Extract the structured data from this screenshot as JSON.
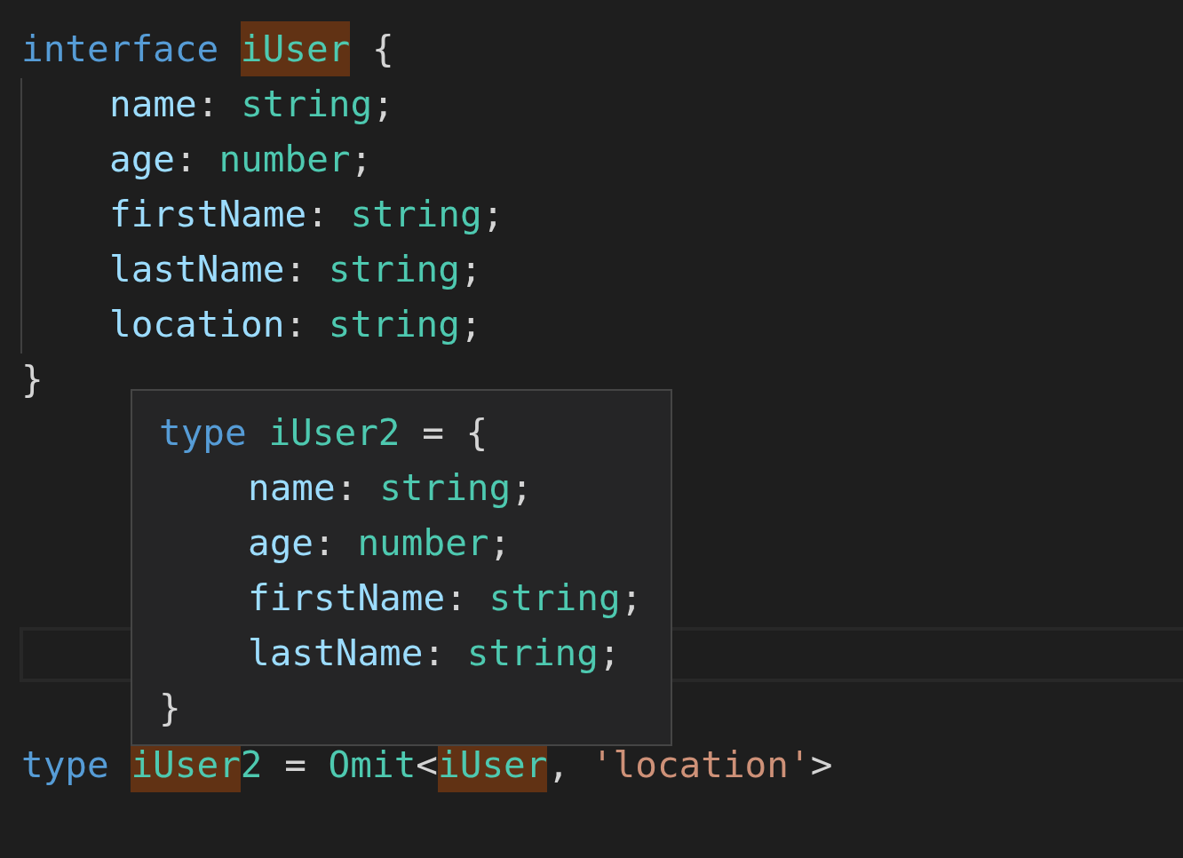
{
  "editor": {
    "lines": [
      {
        "current": false,
        "indented": false,
        "tokens": [
          {
            "text": "interface ",
            "kind": "keyword",
            "highlighted": false
          },
          {
            "text": "iUser",
            "kind": "type",
            "highlighted": true
          },
          {
            "text": " {",
            "kind": "punctuation",
            "highlighted": false
          }
        ]
      },
      {
        "current": false,
        "indented": true,
        "tokens": [
          {
            "text": "name",
            "kind": "property",
            "highlighted": false
          },
          {
            "text": ": ",
            "kind": "punctuation",
            "highlighted": false
          },
          {
            "text": "string",
            "kind": "type",
            "highlighted": false
          },
          {
            "text": ";",
            "kind": "punctuation",
            "highlighted": false
          }
        ]
      },
      {
        "current": false,
        "indented": true,
        "tokens": [
          {
            "text": "age",
            "kind": "property",
            "highlighted": false
          },
          {
            "text": ": ",
            "kind": "punctuation",
            "highlighted": false
          },
          {
            "text": "number",
            "kind": "type",
            "highlighted": false
          },
          {
            "text": ";",
            "kind": "punctuation",
            "highlighted": false
          }
        ]
      },
      {
        "current": false,
        "indented": true,
        "tokens": [
          {
            "text": "firstName",
            "kind": "property",
            "highlighted": false
          },
          {
            "text": ": ",
            "kind": "punctuation",
            "highlighted": false
          },
          {
            "text": "string",
            "kind": "type",
            "highlighted": false
          },
          {
            "text": ";",
            "kind": "punctuation",
            "highlighted": false
          }
        ]
      },
      {
        "current": false,
        "indented": true,
        "tokens": [
          {
            "text": "lastName",
            "kind": "property",
            "highlighted": false
          },
          {
            "text": ": ",
            "kind": "punctuation",
            "highlighted": false
          },
          {
            "text": "string",
            "kind": "type",
            "highlighted": false
          },
          {
            "text": ";",
            "kind": "punctuation",
            "highlighted": false
          }
        ]
      },
      {
        "current": false,
        "indented": true,
        "tokens": [
          {
            "text": "location",
            "kind": "property",
            "highlighted": false
          },
          {
            "text": ": ",
            "kind": "punctuation",
            "highlighted": false
          },
          {
            "text": "string",
            "kind": "type",
            "highlighted": false
          },
          {
            "text": ";",
            "kind": "punctuation",
            "highlighted": false
          }
        ]
      },
      {
        "current": false,
        "indented": false,
        "tokens": [
          {
            "text": "}",
            "kind": "punctuation",
            "highlighted": false
          }
        ]
      },
      {
        "current": false
      },
      {
        "current": false
      },
      {
        "current": false
      },
      {
        "current": false
      },
      {
        "current": true
      },
      {
        "current": false
      },
      {
        "current": false,
        "indented": false,
        "tokens": [
          {
            "text": "type ",
            "kind": "keyword",
            "highlighted": false
          },
          {
            "text": "iUser",
            "kind": "type",
            "highlighted": true
          },
          {
            "text": "2",
            "kind": "type",
            "highlighted": false
          },
          {
            "text": " = ",
            "kind": "punctuation",
            "highlighted": false
          },
          {
            "text": "Omit",
            "kind": "type",
            "highlighted": false
          },
          {
            "text": "<",
            "kind": "punctuation",
            "highlighted": false
          },
          {
            "text": "iUser",
            "kind": "type",
            "highlighted": true
          },
          {
            "text": ", ",
            "kind": "punctuation",
            "highlighted": false
          },
          {
            "text": "'location'",
            "kind": "string",
            "highlighted": false
          },
          {
            "text": ">",
            "kind": "punctuation",
            "highlighted": false
          }
        ]
      }
    ]
  },
  "hover": {
    "lines": [
      {
        "indented": false,
        "tokens": [
          {
            "text": "type ",
            "kind": "keyword"
          },
          {
            "text": "iUser2",
            "kind": "type"
          },
          {
            "text": " = {",
            "kind": "punctuation"
          }
        ]
      },
      {
        "indented": true,
        "tokens": [
          {
            "text": "name",
            "kind": "property"
          },
          {
            "text": ": ",
            "kind": "punctuation"
          },
          {
            "text": "string",
            "kind": "type"
          },
          {
            "text": ";",
            "kind": "punctuation"
          }
        ]
      },
      {
        "indented": true,
        "tokens": [
          {
            "text": "age",
            "kind": "property"
          },
          {
            "text": ": ",
            "kind": "punctuation"
          },
          {
            "text": "number",
            "kind": "type"
          },
          {
            "text": ";",
            "kind": "punctuation"
          }
        ]
      },
      {
        "indented": true,
        "tokens": [
          {
            "text": "firstName",
            "kind": "property"
          },
          {
            "text": ": ",
            "kind": "punctuation"
          },
          {
            "text": "string",
            "kind": "type"
          },
          {
            "text": ";",
            "kind": "punctuation"
          }
        ]
      },
      {
        "indented": true,
        "tokens": [
          {
            "text": "lastName",
            "kind": "property"
          },
          {
            "text": ": ",
            "kind": "punctuation"
          },
          {
            "text": "string",
            "kind": "type"
          },
          {
            "text": ";",
            "kind": "punctuation"
          }
        ]
      },
      {
        "indented": false,
        "tokens": [
          {
            "text": "}",
            "kind": "punctuation"
          }
        ]
      }
    ]
  }
}
